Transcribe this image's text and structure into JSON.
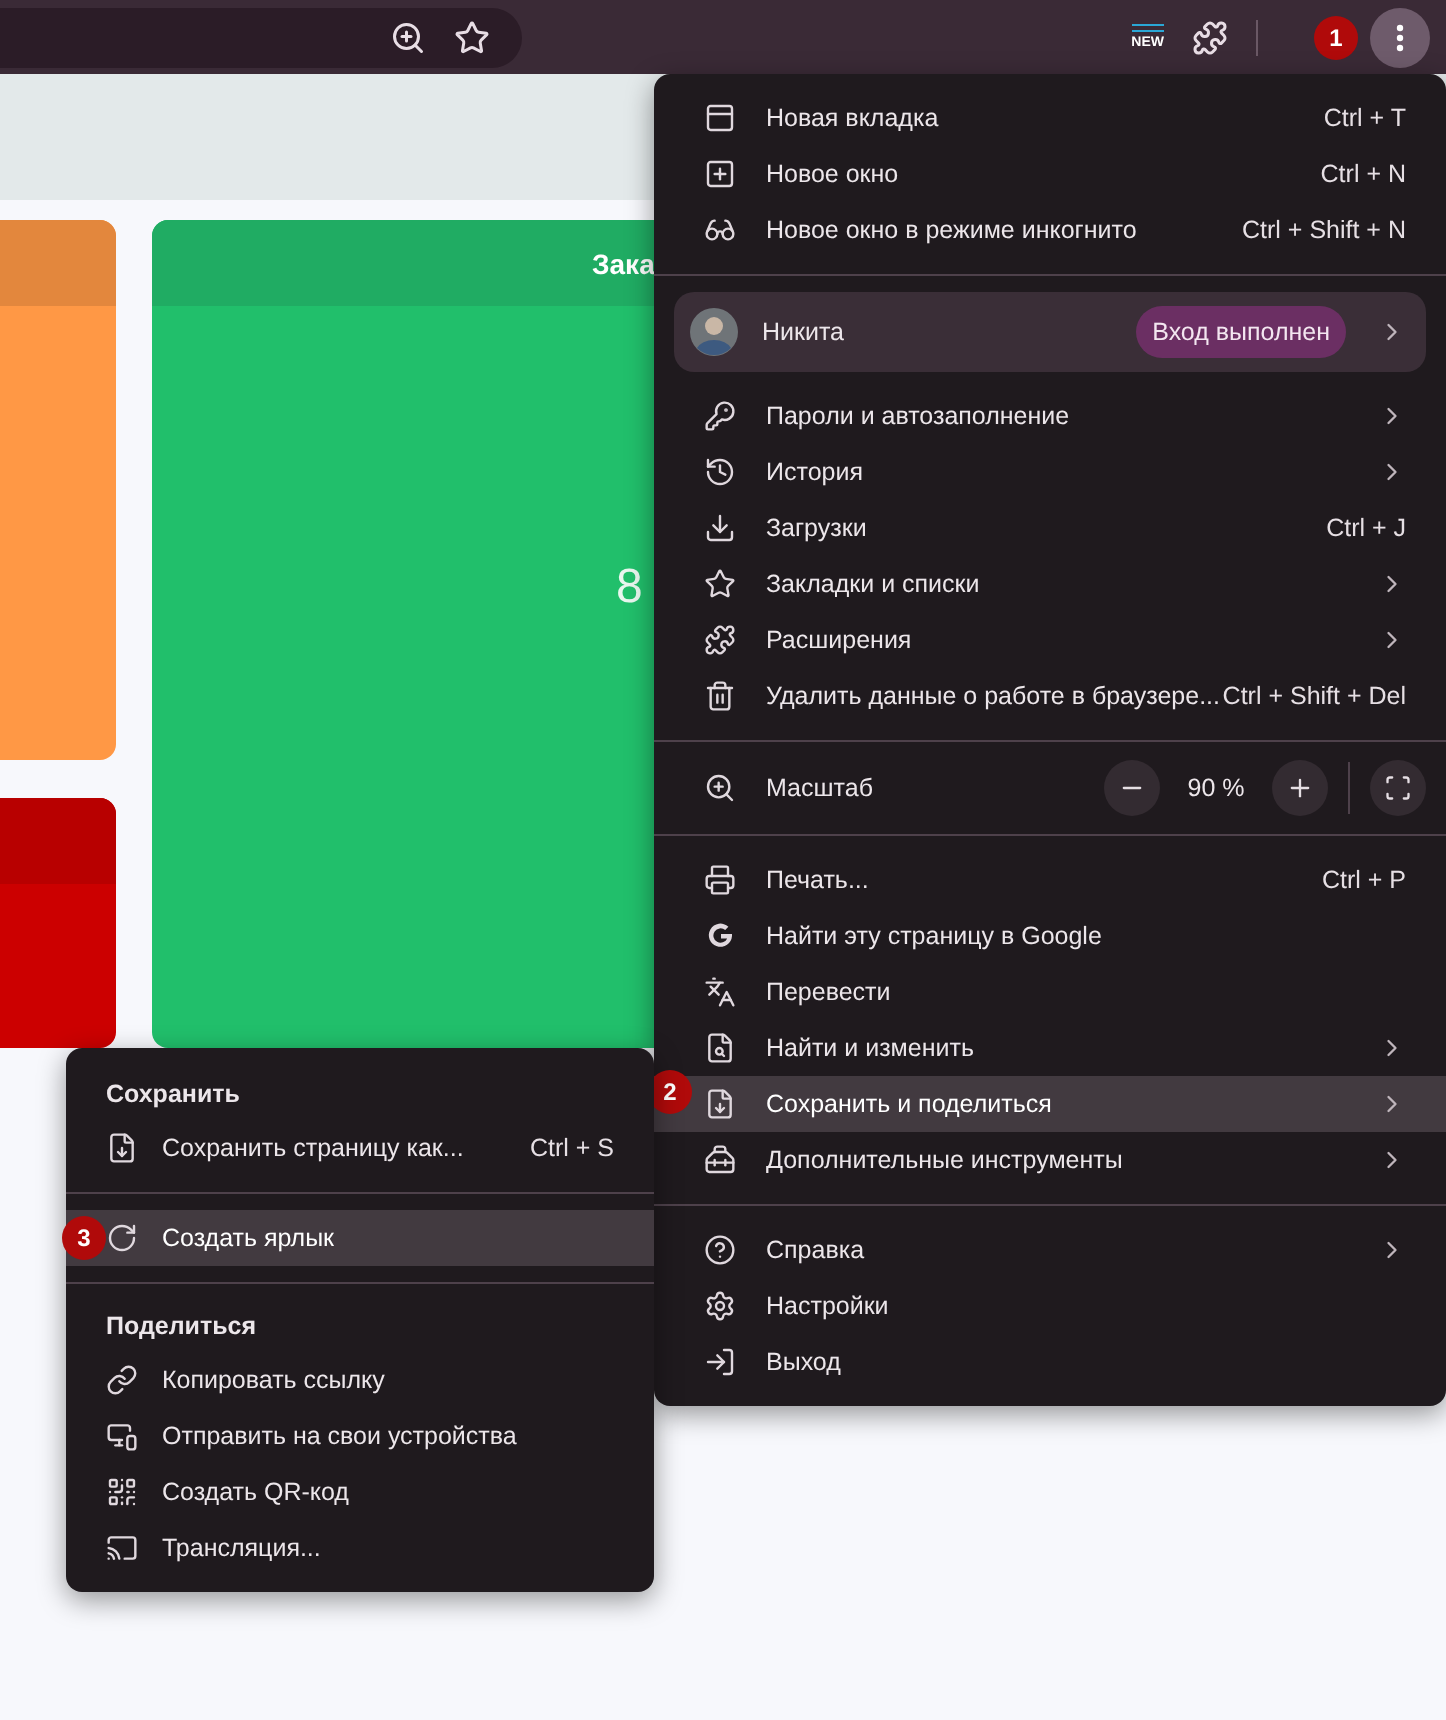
{
  "toolbar": {
    "extension_label": "NEW",
    "step_badge": "1"
  },
  "page": {
    "cards": [
      {
        "kind": "orange"
      },
      {
        "kind": "red"
      },
      {
        "kind": "green",
        "title": "Зака",
        "value": "8"
      }
    ]
  },
  "menu": {
    "sections": [
      {
        "items": [
          {
            "kind": "item",
            "label": "Новая вкладка",
            "shortcut": "Ctrl + T",
            "submenu": false,
            "selected": false
          },
          {
            "kind": "item",
            "label": "Новое окно",
            "shortcut": "Ctrl + N",
            "submenu": false,
            "selected": false
          },
          {
            "kind": "item",
            "label": "Новое окно в режиме инкогнито",
            "shortcut": "Ctrl + Shift + N",
            "submenu": false,
            "selected": false
          }
        ]
      },
      {
        "items": [
          {
            "kind": "profile",
            "label": "Никита",
            "badge": "Вход выполнен",
            "submenu": true
          },
          {
            "kind": "item",
            "label": "Пароли и автозаполнение",
            "submenu": true,
            "selected": false
          },
          {
            "kind": "item",
            "label": "История",
            "submenu": true,
            "selected": false
          },
          {
            "kind": "item",
            "label": "Загрузки",
            "shortcut": "Ctrl + J",
            "submenu": false,
            "selected": false
          },
          {
            "kind": "item",
            "label": "Закладки и списки",
            "submenu": true,
            "selected": false
          },
          {
            "kind": "item",
            "label": "Расширения",
            "submenu": true,
            "selected": false
          },
          {
            "kind": "item",
            "label": "Удалить данные о работе в браузере...",
            "shortcut": "Ctrl + Shift + Del",
            "submenu": false,
            "selected": false
          }
        ]
      },
      {
        "items": [
          {
            "kind": "zoom",
            "label": "Масштаб",
            "value": "90 %"
          }
        ]
      },
      {
        "items": [
          {
            "kind": "item",
            "label": "Печать...",
            "shortcut": "Ctrl + P",
            "submenu": false,
            "selected": false
          },
          {
            "kind": "item",
            "label": "Найти эту страницу в Google",
            "submenu": false,
            "selected": false
          },
          {
            "kind": "item",
            "label": "Перевести",
            "submenu": false,
            "selected": false
          },
          {
            "kind": "item",
            "label": "Найти и изменить",
            "submenu": true,
            "selected": false
          },
          {
            "kind": "item",
            "label": "Сохранить и поделиться",
            "submenu": true,
            "selected": true,
            "step_badge": "2"
          },
          {
            "kind": "item",
            "label": "Дополнительные инструменты",
            "submenu": true,
            "selected": false
          }
        ]
      },
      {
        "items": [
          {
            "kind": "item",
            "label": "Справка",
            "submenu": true,
            "selected": false
          },
          {
            "kind": "item",
            "label": "Настройки",
            "submenu": false,
            "selected": false
          },
          {
            "kind": "item",
            "label": "Выход",
            "submenu": false,
            "selected": false
          }
        ]
      }
    ]
  },
  "submenu": {
    "sections": [
      {
        "heading": "Сохранить",
        "items": [
          {
            "label": "Сохранить страницу как...",
            "shortcut": "Ctrl + S",
            "selected": false
          }
        ]
      },
      {
        "items": [
          {
            "label": "Создать ярлык",
            "selected": true,
            "step_badge": "3"
          }
        ]
      },
      {
        "heading": "Поделиться",
        "items": [
          {
            "label": "Копировать ссылку",
            "selected": false
          },
          {
            "label": "Отправить на свои устройства",
            "selected": false
          },
          {
            "label": "Создать QR-код",
            "selected": false
          },
          {
            "label": "Трансляция...",
            "selected": false
          }
        ]
      }
    ]
  }
}
